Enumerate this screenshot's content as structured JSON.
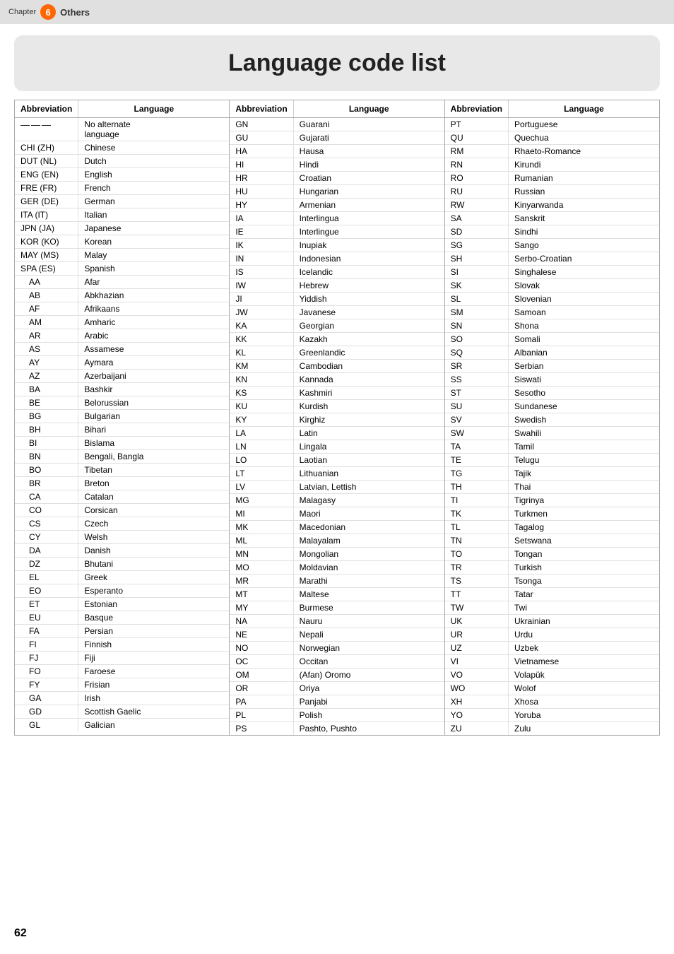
{
  "topbar": {
    "chapter_label": "Chapter",
    "chapter_number": "6",
    "others_label": "Others"
  },
  "title": "Language code list",
  "columns": [
    {
      "header_abbr": "Abbreviation",
      "header_lang": "Language",
      "rows": [
        {
          "abbr": "———",
          "lang": "No alternate language",
          "indent": false,
          "multiline": true
        },
        {
          "abbr": "CHI (ZH)",
          "lang": "Chinese",
          "indent": false
        },
        {
          "abbr": "DUT (NL)",
          "lang": "Dutch",
          "indent": false
        },
        {
          "abbr": "ENG (EN)",
          "lang": "English",
          "indent": false
        },
        {
          "abbr": "FRE (FR)",
          "lang": "French",
          "indent": false
        },
        {
          "abbr": "GER (DE)",
          "lang": "German",
          "indent": false
        },
        {
          "abbr": "ITA (IT)",
          "lang": "Italian",
          "indent": false
        },
        {
          "abbr": "JPN (JA)",
          "lang": "Japanese",
          "indent": false
        },
        {
          "abbr": "KOR (KO)",
          "lang": "Korean",
          "indent": false
        },
        {
          "abbr": "MAY (MS)",
          "lang": "Malay",
          "indent": false
        },
        {
          "abbr": "SPA (ES)",
          "lang": "Spanish",
          "indent": false
        },
        {
          "abbr": "AA",
          "lang": "Afar",
          "indent": true
        },
        {
          "abbr": "AB",
          "lang": "Abkhazian",
          "indent": true
        },
        {
          "abbr": "AF",
          "lang": "Afrikaans",
          "indent": true
        },
        {
          "abbr": "AM",
          "lang": "Amharic",
          "indent": true
        },
        {
          "abbr": "AR",
          "lang": "Arabic",
          "indent": true
        },
        {
          "abbr": "AS",
          "lang": "Assamese",
          "indent": true
        },
        {
          "abbr": "AY",
          "lang": "Aymara",
          "indent": true
        },
        {
          "abbr": "AZ",
          "lang": "Azerbaijani",
          "indent": true
        },
        {
          "abbr": "BA",
          "lang": "Bashkir",
          "indent": true
        },
        {
          "abbr": "BE",
          "lang": "Belorussian",
          "indent": true
        },
        {
          "abbr": "BG",
          "lang": "Bulgarian",
          "indent": true
        },
        {
          "abbr": "BH",
          "lang": "Bihari",
          "indent": true
        },
        {
          "abbr": "BI",
          "lang": "Bislama",
          "indent": true
        },
        {
          "abbr": "BN",
          "lang": "Bengali, Bangla",
          "indent": true
        },
        {
          "abbr": "BO",
          "lang": "Tibetan",
          "indent": true
        },
        {
          "abbr": "BR",
          "lang": "Breton",
          "indent": true
        },
        {
          "abbr": "CA",
          "lang": "Catalan",
          "indent": true
        },
        {
          "abbr": "CO",
          "lang": "Corsican",
          "indent": true
        },
        {
          "abbr": "CS",
          "lang": "Czech",
          "indent": true
        },
        {
          "abbr": "CY",
          "lang": "Welsh",
          "indent": true
        },
        {
          "abbr": "DA",
          "lang": "Danish",
          "indent": true
        },
        {
          "abbr": "DZ",
          "lang": "Bhutani",
          "indent": true
        },
        {
          "abbr": "EL",
          "lang": "Greek",
          "indent": true
        },
        {
          "abbr": "EO",
          "lang": "Esperanto",
          "indent": true
        },
        {
          "abbr": "ET",
          "lang": "Estonian",
          "indent": true
        },
        {
          "abbr": "EU",
          "lang": "Basque",
          "indent": true
        },
        {
          "abbr": "FA",
          "lang": "Persian",
          "indent": true
        },
        {
          "abbr": "FI",
          "lang": "Finnish",
          "indent": true
        },
        {
          "abbr": "FJ",
          "lang": "Fiji",
          "indent": true
        },
        {
          "abbr": "FO",
          "lang": "Faroese",
          "indent": true
        },
        {
          "abbr": "FY",
          "lang": "Frisian",
          "indent": true
        },
        {
          "abbr": "GA",
          "lang": "Irish",
          "indent": true
        },
        {
          "abbr": "GD",
          "lang": "Scottish Gaelic",
          "indent": true
        },
        {
          "abbr": "GL",
          "lang": "Galician",
          "indent": true
        }
      ]
    },
    {
      "header_abbr": "Abbreviation",
      "header_lang": "Language",
      "rows": [
        {
          "abbr": "GN",
          "lang": "Guarani"
        },
        {
          "abbr": "GU",
          "lang": "Gujarati"
        },
        {
          "abbr": "HA",
          "lang": "Hausa"
        },
        {
          "abbr": "HI",
          "lang": "Hindi"
        },
        {
          "abbr": "HR",
          "lang": "Croatian"
        },
        {
          "abbr": "HU",
          "lang": "Hungarian"
        },
        {
          "abbr": "HY",
          "lang": "Armenian"
        },
        {
          "abbr": "IA",
          "lang": "Interlingua"
        },
        {
          "abbr": "IE",
          "lang": "Interlingue"
        },
        {
          "abbr": "IK",
          "lang": "Inupiak"
        },
        {
          "abbr": "IN",
          "lang": "Indonesian"
        },
        {
          "abbr": "IS",
          "lang": "Icelandic"
        },
        {
          "abbr": "IW",
          "lang": "Hebrew"
        },
        {
          "abbr": "JI",
          "lang": "Yiddish"
        },
        {
          "abbr": "JW",
          "lang": "Javanese"
        },
        {
          "abbr": "KA",
          "lang": "Georgian"
        },
        {
          "abbr": "KK",
          "lang": "Kazakh"
        },
        {
          "abbr": "KL",
          "lang": "Greenlandic"
        },
        {
          "abbr": "KM",
          "lang": "Cambodian"
        },
        {
          "abbr": "KN",
          "lang": "Kannada"
        },
        {
          "abbr": "KS",
          "lang": "Kashmiri"
        },
        {
          "abbr": "KU",
          "lang": "Kurdish"
        },
        {
          "abbr": "KY",
          "lang": "Kirghiz"
        },
        {
          "abbr": "LA",
          "lang": "Latin"
        },
        {
          "abbr": "LN",
          "lang": "Lingala"
        },
        {
          "abbr": "LO",
          "lang": "Laotian"
        },
        {
          "abbr": "LT",
          "lang": "Lithuanian"
        },
        {
          "abbr": "LV",
          "lang": "Latvian, Lettish"
        },
        {
          "abbr": "MG",
          "lang": "Malagasy"
        },
        {
          "abbr": "MI",
          "lang": "Maori"
        },
        {
          "abbr": "MK",
          "lang": "Macedonian"
        },
        {
          "abbr": "ML",
          "lang": "Malayalam"
        },
        {
          "abbr": "MN",
          "lang": "Mongolian"
        },
        {
          "abbr": "MO",
          "lang": "Moldavian"
        },
        {
          "abbr": "MR",
          "lang": "Marathi"
        },
        {
          "abbr": "MT",
          "lang": "Maltese"
        },
        {
          "abbr": "MY",
          "lang": "Burmese"
        },
        {
          "abbr": "NA",
          "lang": "Nauru"
        },
        {
          "abbr": "NE",
          "lang": "Nepali"
        },
        {
          "abbr": "NO",
          "lang": "Norwegian"
        },
        {
          "abbr": "OC",
          "lang": "Occitan"
        },
        {
          "abbr": "OM",
          "lang": "(Afan) Oromo"
        },
        {
          "abbr": "OR",
          "lang": "Oriya"
        },
        {
          "abbr": "PA",
          "lang": "Panjabi"
        },
        {
          "abbr": "PL",
          "lang": "Polish"
        },
        {
          "abbr": "PS",
          "lang": "Pashto, Pushto"
        }
      ]
    },
    {
      "header_abbr": "Abbreviation",
      "header_lang": "Language",
      "rows": [
        {
          "abbr": "PT",
          "lang": "Portuguese"
        },
        {
          "abbr": "QU",
          "lang": "Quechua"
        },
        {
          "abbr": "RM",
          "lang": "Rhaeto-Romance"
        },
        {
          "abbr": "RN",
          "lang": "Kirundi"
        },
        {
          "abbr": "RO",
          "lang": "Rumanian"
        },
        {
          "abbr": "RU",
          "lang": "Russian"
        },
        {
          "abbr": "RW",
          "lang": "Kinyarwanda"
        },
        {
          "abbr": "SA",
          "lang": "Sanskrit"
        },
        {
          "abbr": "SD",
          "lang": "Sindhi"
        },
        {
          "abbr": "SG",
          "lang": "Sango"
        },
        {
          "abbr": "SH",
          "lang": "Serbo-Croatian"
        },
        {
          "abbr": "SI",
          "lang": "Singhalese"
        },
        {
          "abbr": "SK",
          "lang": "Slovak"
        },
        {
          "abbr": "SL",
          "lang": "Slovenian"
        },
        {
          "abbr": "SM",
          "lang": "Samoan"
        },
        {
          "abbr": "SN",
          "lang": "Shona"
        },
        {
          "abbr": "SO",
          "lang": "Somali"
        },
        {
          "abbr": "SQ",
          "lang": "Albanian"
        },
        {
          "abbr": "SR",
          "lang": "Serbian"
        },
        {
          "abbr": "SS",
          "lang": "Siswati"
        },
        {
          "abbr": "ST",
          "lang": "Sesotho"
        },
        {
          "abbr": "SU",
          "lang": "Sundanese"
        },
        {
          "abbr": "SV",
          "lang": "Swedish"
        },
        {
          "abbr": "SW",
          "lang": "Swahili"
        },
        {
          "abbr": "TA",
          "lang": "Tamil"
        },
        {
          "abbr": "TE",
          "lang": "Telugu"
        },
        {
          "abbr": "TG",
          "lang": "Tajik"
        },
        {
          "abbr": "TH",
          "lang": "Thai"
        },
        {
          "abbr": "TI",
          "lang": "Tigrinya"
        },
        {
          "abbr": "TK",
          "lang": "Turkmen"
        },
        {
          "abbr": "TL",
          "lang": "Tagalog"
        },
        {
          "abbr": "TN",
          "lang": "Setswana"
        },
        {
          "abbr": "TO",
          "lang": "Tongan"
        },
        {
          "abbr": "TR",
          "lang": "Turkish"
        },
        {
          "abbr": "TS",
          "lang": "Tsonga"
        },
        {
          "abbr": "TT",
          "lang": "Tatar"
        },
        {
          "abbr": "TW",
          "lang": "Twi"
        },
        {
          "abbr": "UK",
          "lang": "Ukrainian"
        },
        {
          "abbr": "UR",
          "lang": "Urdu"
        },
        {
          "abbr": "UZ",
          "lang": "Uzbek"
        },
        {
          "abbr": "VI",
          "lang": "Vietnamese"
        },
        {
          "abbr": "VO",
          "lang": "Volapük"
        },
        {
          "abbr": "WO",
          "lang": "Wolof"
        },
        {
          "abbr": "XH",
          "lang": "Xhosa"
        },
        {
          "abbr": "YO",
          "lang": "Yoruba"
        },
        {
          "abbr": "ZU",
          "lang": "Zulu"
        }
      ]
    }
  ],
  "page_number": "62"
}
